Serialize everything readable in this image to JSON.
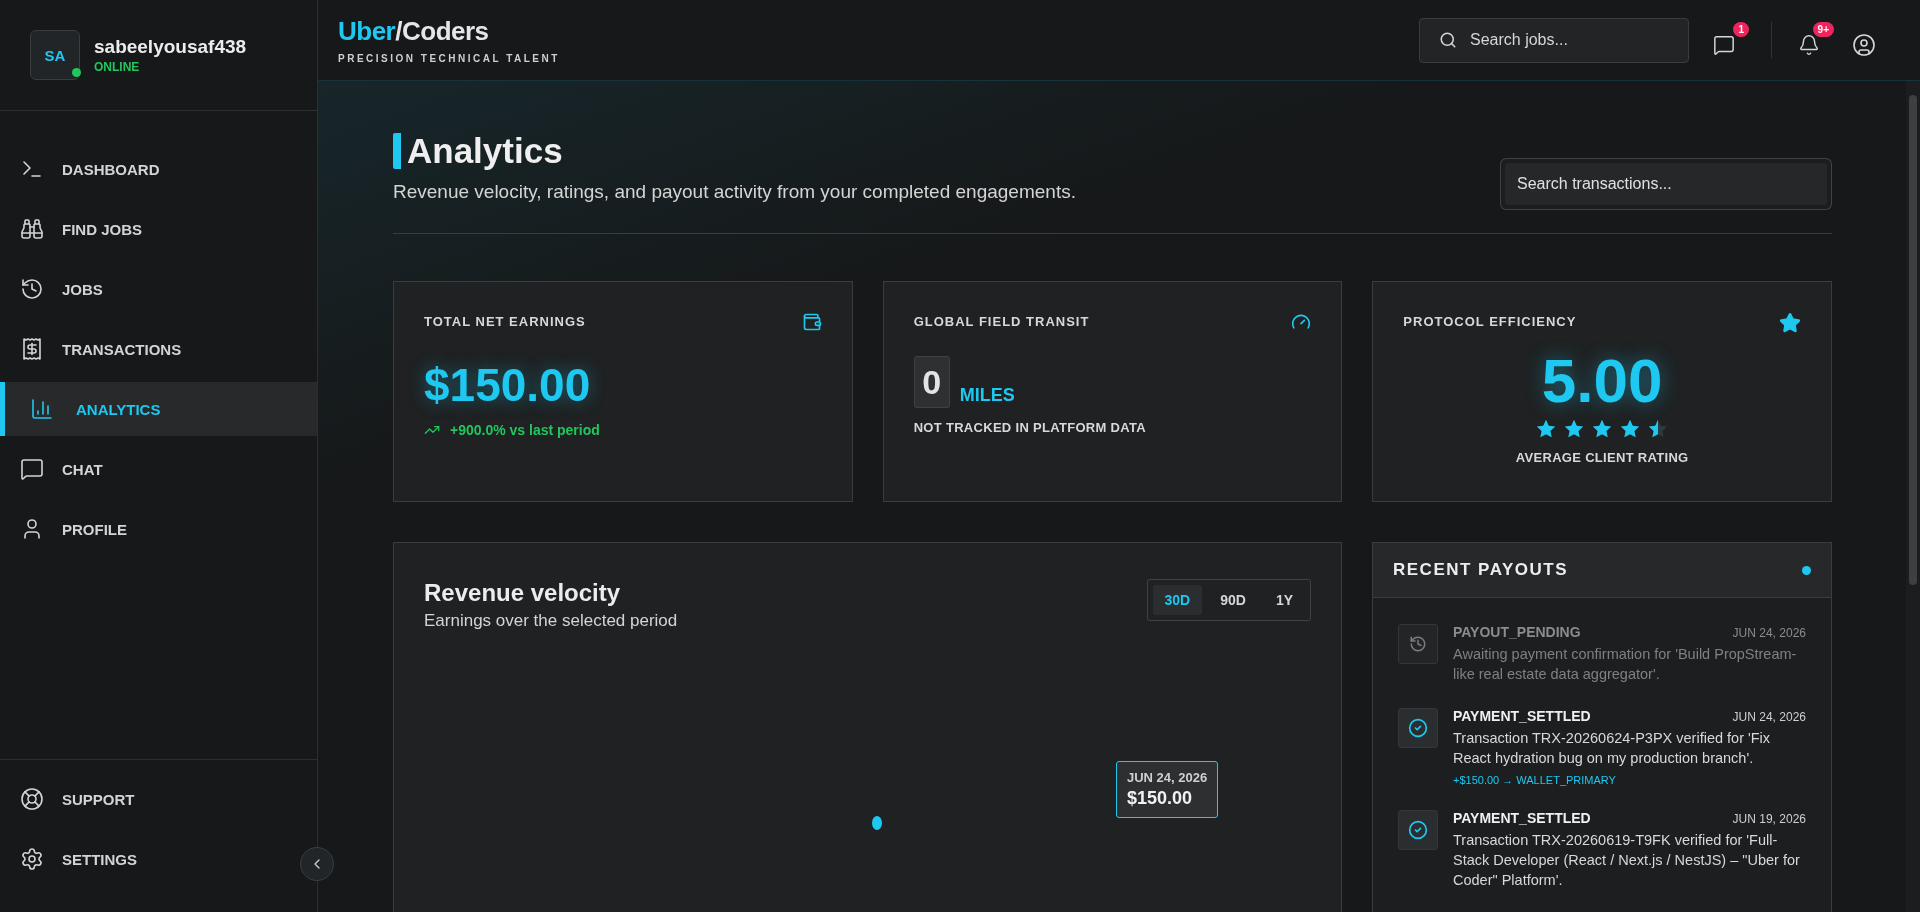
{
  "user": {
    "initials": "SA",
    "name": "sabeelyousaf438",
    "status": "ONLINE",
    "online": true
  },
  "nav": [
    {
      "label": "DASHBOARD",
      "selected": false
    },
    {
      "label": "FIND JOBS",
      "selected": false
    },
    {
      "label": "JOBS",
      "selected": false
    },
    {
      "label": "TRANSACTIONS",
      "selected": false
    },
    {
      "label": "ANALYTICS",
      "selected": true
    },
    {
      "label": "CHAT",
      "selected": false
    },
    {
      "label": "PROFILE",
      "selected": false
    }
  ],
  "footer_nav": [
    {
      "label": "SUPPORT"
    },
    {
      "label": "SETTINGS"
    }
  ],
  "brand": {
    "accent": "Uber",
    "rest": "/Coders",
    "tagline": "PRECISION TECHNICAL TALENT"
  },
  "header": {
    "search": {
      "placeholder": "Search jobs..."
    },
    "messages_badge": "1",
    "notifications_badge": "9+"
  },
  "page": {
    "title": "Analytics",
    "subtitle": "Revenue velocity, ratings, and payout activity from your completed engagements.",
    "search": {
      "placeholder": "Search transactions..."
    }
  },
  "stats": [
    {
      "kind": "money",
      "label": "TOTAL NET EARNINGS",
      "value": "$150.00",
      "trend": "+900.0% vs last period"
    },
    {
      "kind": "distance",
      "label": "GLOBAL FIELD TRANSIT",
      "value": "0",
      "unit": "MILES",
      "note": "NOT TRACKED IN PLATFORM DATA"
    },
    {
      "kind": "rating",
      "label": "PROTOCOL EFFICIENCY",
      "value": "5.00",
      "stars": 4.5,
      "note": "AVERAGE CLIENT RATING"
    }
  ],
  "revenue": {
    "title": "Revenue velocity",
    "subtitle": "Earnings over the selected period",
    "ranges": [
      {
        "label": "30D",
        "selected": true
      },
      {
        "label": "90D",
        "selected": false
      },
      {
        "label": "1Y",
        "selected": false
      }
    ],
    "tooltip": {
      "date": "JUN 24, 2026",
      "amount": "$150.00"
    }
  },
  "payouts": {
    "title": "RECENT PAYOUTS",
    "live": true,
    "items": [
      {
        "kind": "pending",
        "title": "PAYOUT_PENDING",
        "date": "JUN 24, 2026",
        "text": "Awaiting payment confirmation for 'Build PropStream-like real estate data aggregator'."
      },
      {
        "kind": "settled",
        "title": "PAYMENT_SETTLED",
        "date": "JUN 24, 2026",
        "text": "Transaction TRX-20260624-P3PX verified for 'Fix React hydration bug on my production branch'.",
        "amount": "+$150.00 → WALLET_PRIMARY"
      },
      {
        "kind": "settled",
        "title": "PAYMENT_SETTLED",
        "date": "JUN 19, 2026",
        "text": "Transaction TRX-20260619-T9FK verified for 'Full-Stack Developer (React / Next.js / NestJS) – \"Uber for Coder\" Platform'."
      }
    ]
  }
}
